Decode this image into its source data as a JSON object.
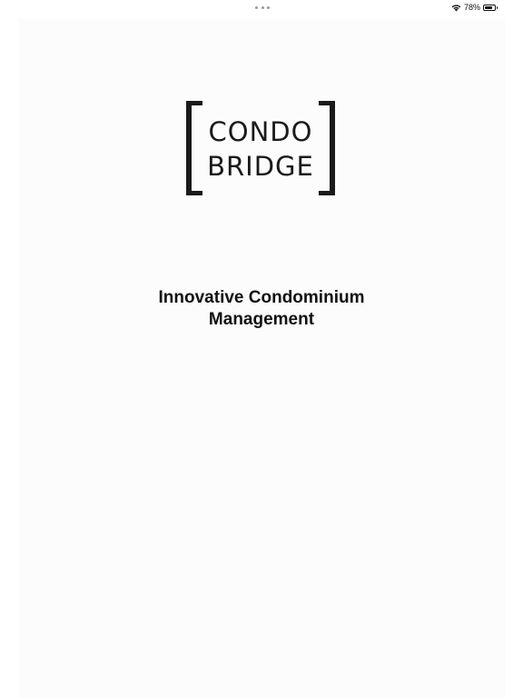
{
  "status_bar": {
    "battery_percent_label": "78%",
    "battery_level": 0.78,
    "wifi_icon": "wifi-icon",
    "battery_icon": "battery-icon",
    "multitask_icon": "multitasking-dots-icon"
  },
  "logo": {
    "line1": "CONDO",
    "line2": "BRIDGE"
  },
  "tagline": {
    "line1": "Innovative Condominium",
    "line2": "Management"
  },
  "colors": {
    "text": "#111111",
    "background": "#ffffff"
  }
}
